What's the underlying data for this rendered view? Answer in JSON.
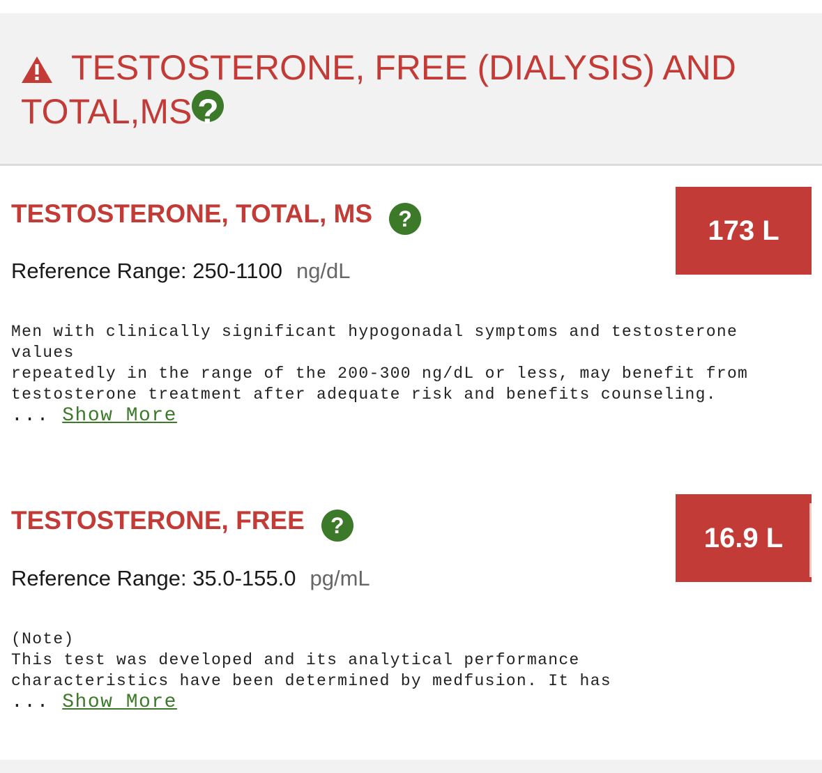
{
  "header": {
    "title": "TESTOSTERONE, FREE (DIALYSIS) AND TOTAL,MS",
    "warning_icon": "warning-triangle-icon",
    "help_icon_glyph": "?"
  },
  "tests": [
    {
      "name": "TESTOSTERONE, TOTAL, MS",
      "help_icon_glyph": "?",
      "value": "173 L",
      "reference_label": "Reference Range:",
      "reference_range": "250-1100",
      "unit": "ng/dL",
      "note": "Men with clinically significant hypogonadal symptoms and testosterone\nvalues\nrepeatedly in the range of the 200-300 ng/dL or less, may benefit from\ntestosterone treatment after adequate risk and benefits counseling.",
      "ellipsis": "...",
      "show_more_label": "Show More"
    },
    {
      "name": "TESTOSTERONE, FREE",
      "help_icon_glyph": "?",
      "value": "16.9 L",
      "reference_label": "Reference Range:",
      "reference_range": "35.0-155.0",
      "unit": "pg/mL",
      "note": "(Note)\nThis test was developed and its analytical performance\ncharacteristics have been determined by medfusion. It has",
      "ellipsis": "...",
      "show_more_label": "Show More"
    }
  ],
  "colors": {
    "accent_red": "#c23b36",
    "help_green": "#3c7a2a",
    "header_bg": "#f2f2f2"
  }
}
